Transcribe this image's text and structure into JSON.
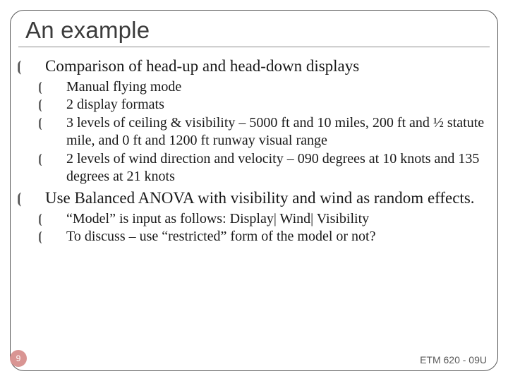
{
  "title": "An example",
  "body": {
    "p1": "Comparison of head-up and head-down displays",
    "p1_sub": {
      "s1": "Manual flying mode",
      "s2": "2 display formats",
      "s3": "3 levels of ceiling & visibility – 5000 ft and 10 miles, 200 ft and ½ statute mile, and 0 ft and 1200 ft runway visual range",
      "s4": "2 levels of wind direction and velocity – 090 degrees at 10 knots and 135 degrees at 21 knots"
    },
    "p2": "Use Balanced ANOVA with visibility and wind as random effects.",
    "p2_sub": {
      "s1": "“Model” is input as follows: Display| Wind| Visibility",
      "s2": "To discuss – use “restricted” form of the model or not?"
    }
  },
  "page_number": "9",
  "footer": "ETM 620 - 09U",
  "bullet_glyph": ""
}
